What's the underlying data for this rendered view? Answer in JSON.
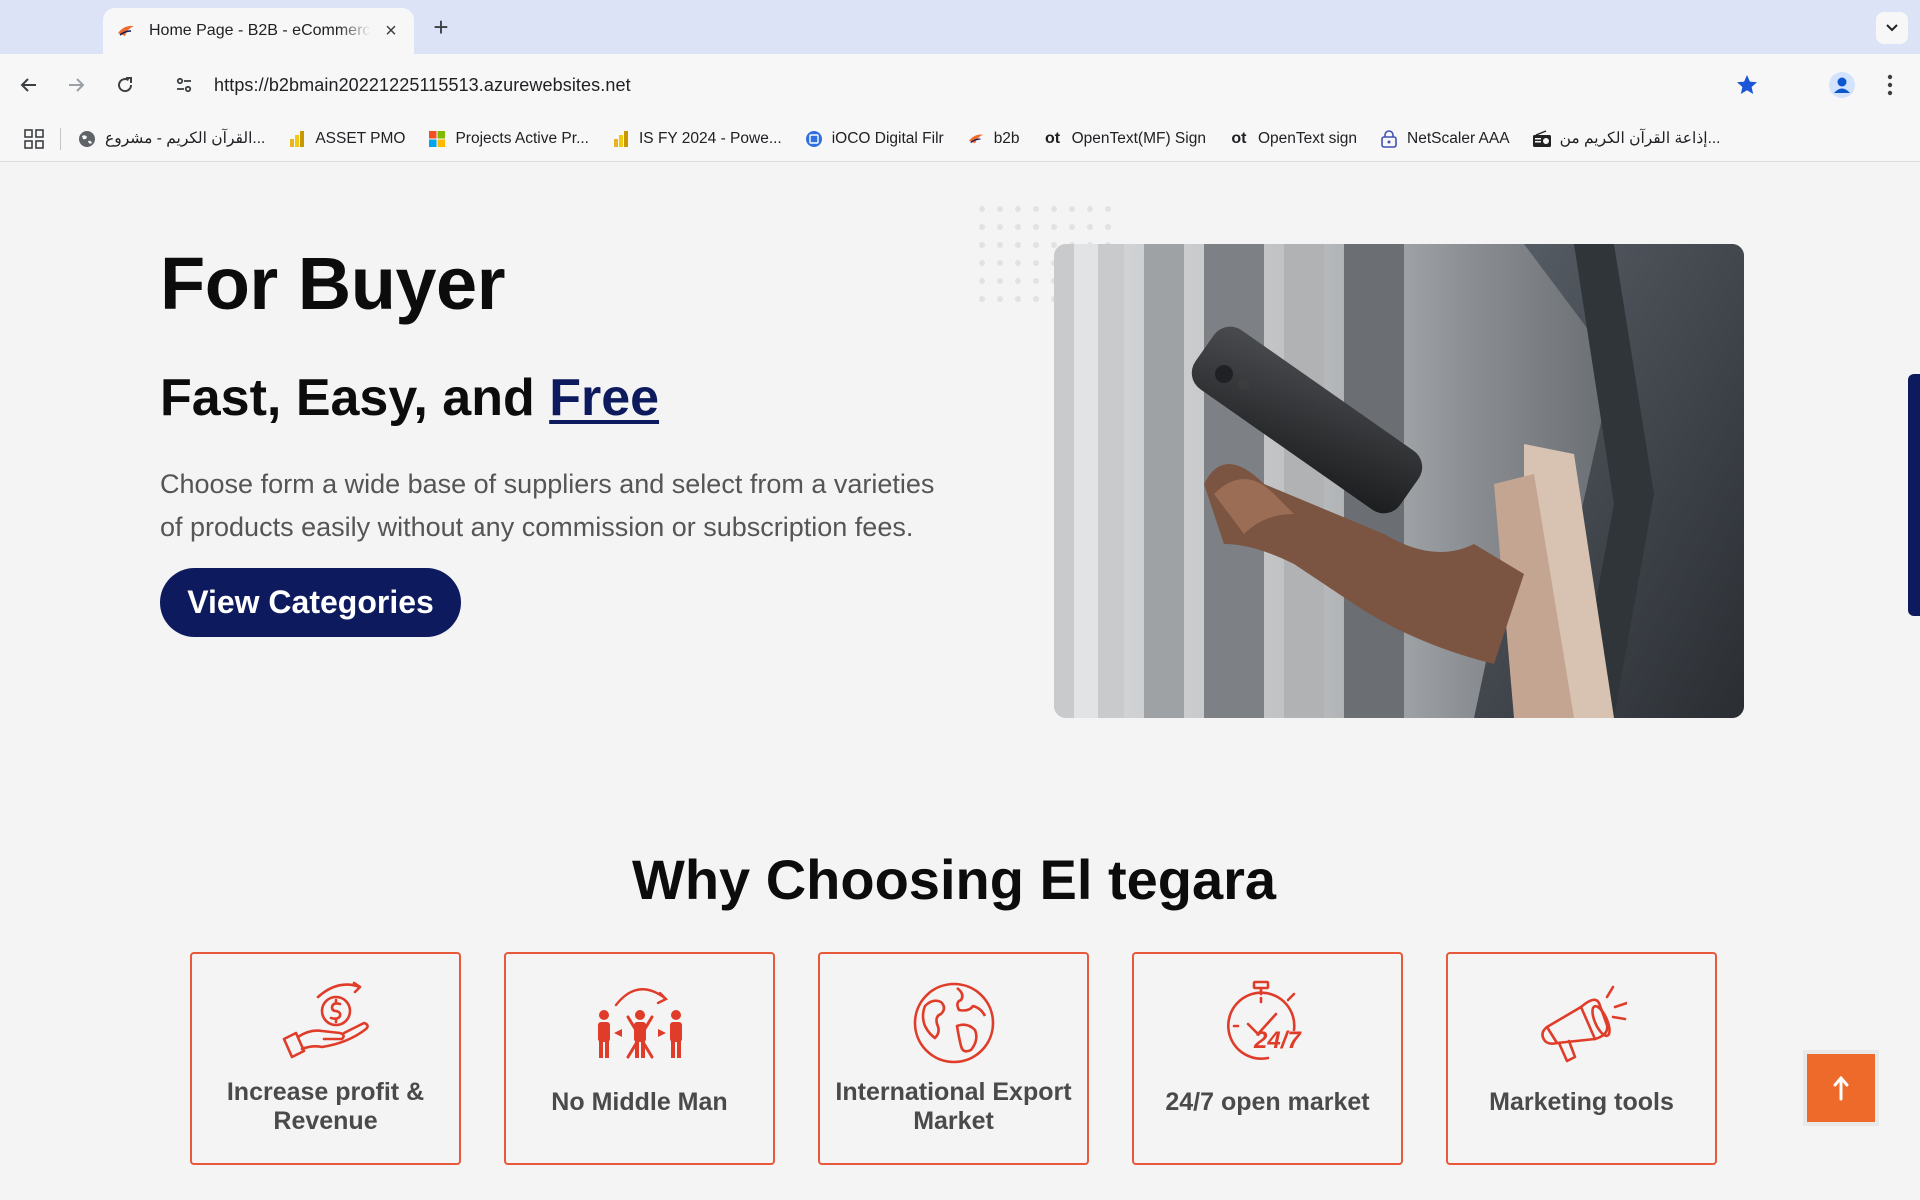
{
  "browser": {
    "tab_title": "Home Page - B2B - eCommerce",
    "url": "https://b2bmain20221225115513.azurewebsites.net",
    "bookmarks": [
      {
        "label": "القرآن الكريم - مشروع...",
        "icon": "globe-icon"
      },
      {
        "label": "ASSET PMO",
        "icon": "powerbi-icon"
      },
      {
        "label": "Projects Active Pr...",
        "icon": "microsoft-icon"
      },
      {
        "label": "IS FY 2024 - Powe...",
        "icon": "powerbi-icon"
      },
      {
        "label": "iOCO Digital Filr",
        "icon": "filr-icon"
      },
      {
        "label": "b2b",
        "icon": "b2b-favicon"
      },
      {
        "label": "OpenText(MF) Sign",
        "icon": "opentext-icon"
      },
      {
        "label": "OpenText sign",
        "icon": "opentext-icon"
      },
      {
        "label": "NetScaler AAA",
        "icon": "lock-icon"
      },
      {
        "label": "إذاعة القرآن الكريم من...",
        "icon": "radio-icon"
      }
    ]
  },
  "hero": {
    "title": "For Buyer",
    "subtitle_prefix": "Fast, Easy, and ",
    "subtitle_highlight": "Free",
    "description": "Choose form a wide base of suppliers and select from a varieties of products easily without any commission or subscription fees.",
    "cta_label": "View Categories"
  },
  "why": {
    "title": "Why Choosing El tegara",
    "cards": [
      {
        "label": "Increase profit & Revenue",
        "icon": "money-hand-icon"
      },
      {
        "label": "No Middle Man",
        "icon": "no-middleman-icon"
      },
      {
        "label": "International Export Market",
        "icon": "globe-icon"
      },
      {
        "label": "24/7 open market",
        "icon": "stopwatch-247-icon"
      },
      {
        "label": "Marketing tools",
        "icon": "megaphone-icon"
      }
    ]
  },
  "colors": {
    "brand_navy": "#0d1b5e",
    "accent_orange": "#e8583a",
    "scroll_top_button": "#ee6a2b"
  },
  "scroll_top_label": "↑"
}
